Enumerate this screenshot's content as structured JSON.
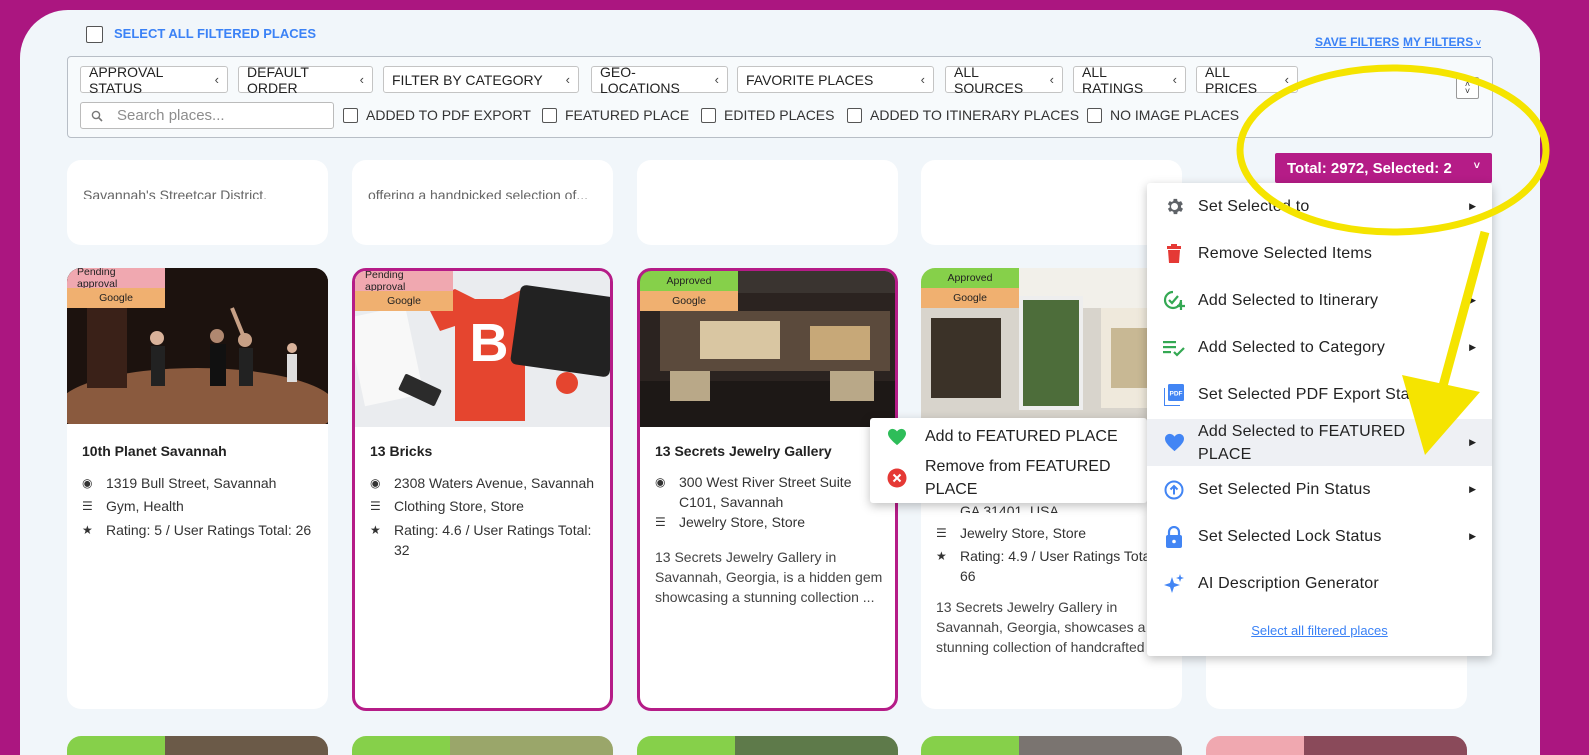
{
  "header": {
    "select_all_label": "SELECT ALL FILTERED PLACES",
    "save_filters": "SAVE FILTERS",
    "my_filters": "MY FILTERS"
  },
  "filters": {
    "dropdowns": [
      "APPROVAL STATUS",
      "DEFAULT ORDER",
      "FILTER BY CATEGORY",
      "GEO-LOCATIONS",
      "FAVORITE PLACES",
      "ALL SOURCES",
      "ALL RATINGS",
      "ALL PRICES"
    ],
    "search_placeholder": "Search places...",
    "checkboxes": [
      "ADDED TO PDF EXPORT",
      "FEATURED PLACE",
      "EDITED PLACES",
      "ADDED TO ITINERARY PLACES",
      "NO IMAGE PLACES"
    ]
  },
  "total_button": "Total: 2972, Selected: 2",
  "top_cards": {
    "snippet_1": "Savannah's Streetcar District. Historic...",
    "snippet_2": "offering a handpicked selection of..."
  },
  "cards": [
    {
      "status": "Pending approval",
      "source": "Google",
      "name": "10th Planet Savannah",
      "address": "1319 Bull Street, Savannah",
      "category": "Gym, Health",
      "rating": "Rating: 5 / User Ratings Total: 26"
    },
    {
      "status": "Pending approval",
      "source": "Google",
      "name": "13 Bricks",
      "address": "2308 Waters Avenue, Savannah",
      "category": "Clothing Store, Store",
      "rating_line1": "Rating: 4.6 / User Ratings Total:",
      "rating_line2": "32"
    },
    {
      "status": "Approved",
      "source": "Google",
      "name": "13 Secrets Jewelry Gallery",
      "address_line1": "300 West River Street Suite",
      "address_line2": "C101, Savannah",
      "category": "Jewelry Store, Store",
      "desc": [
        "13 Secrets Jewelry Gallery in",
        "Savannah, Georgia, is a hidden gem",
        "showcasing a stunning collection ..."
      ]
    },
    {
      "status": "Approved",
      "source": "Google",
      "address_partial": "GA 31401, USA",
      "category": "Jewelry Store, Store",
      "rating_line1": "Rating: 4.9 / User Ratings Total:",
      "rating_line2": "66",
      "desc": [
        "13 Secrets Jewelry Gallery in",
        "Savannah, Georgia, showcases a",
        "stunning collection of handcrafted"
      ]
    }
  ],
  "menu": {
    "items": [
      {
        "label": "Set Selected to",
        "icon": "gear-icon",
        "color": "#555555"
      },
      {
        "label": "Remove Selected Items",
        "icon": "trash-icon",
        "color": "#e53935"
      },
      {
        "label": "Add Selected to Itinerary",
        "icon": "itinerary-add-icon",
        "color": "#34a853"
      },
      {
        "label": "Add Selected to Category",
        "icon": "category-list-icon",
        "color": "#34a853"
      },
      {
        "label": "Set Selected PDF Export Status",
        "icon": "pdf-icon",
        "color": "#4285f4"
      },
      {
        "label_line1": "Add Selected to FEATURED",
        "label_line2": "PLACE",
        "icon": "heart-icon",
        "color": "#4285f4"
      },
      {
        "label": "Set Selected Pin Status",
        "icon": "pin-up-icon",
        "color": "#4285f4"
      },
      {
        "label": "Set Selected Lock Status",
        "icon": "lock-icon",
        "color": "#4285f4"
      },
      {
        "label": "AI Description Generator",
        "icon": "sparkle-icon",
        "color": "#4285f4"
      }
    ],
    "footer_link": "Select all filtered places"
  },
  "submenu": {
    "add": "Add to FEATURED PLACE",
    "remove_line1": "Remove from FEATURED",
    "remove_line2": "PLACE"
  },
  "colors": {
    "brand": "#b51c87",
    "highlight_annotation": "#f5e400",
    "approved": "#86d04a",
    "pending": "#f0a8b0"
  }
}
